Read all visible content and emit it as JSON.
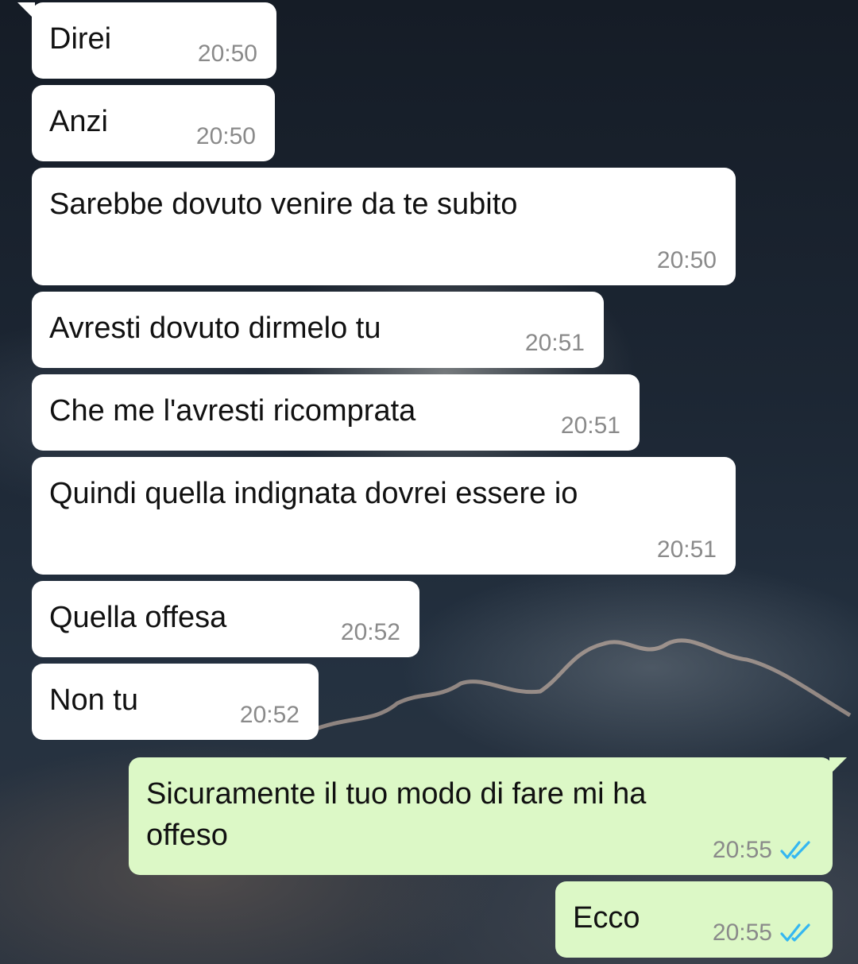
{
  "messages": [
    {
      "text": "Direi",
      "time": "20:50",
      "direction": "incoming"
    },
    {
      "text": "Anzi",
      "time": "20:50",
      "direction": "incoming"
    },
    {
      "text": "Sarebbe dovuto venire da te subito",
      "time": "20:50",
      "direction": "incoming"
    },
    {
      "text": "Avresti dovuto dirmelo tu",
      "time": "20:51",
      "direction": "incoming"
    },
    {
      "text": "Che me l'avresti ricomprata",
      "time": "20:51",
      "direction": "incoming"
    },
    {
      "text": "Quindi quella indignata dovrei essere io",
      "time": "20:51",
      "direction": "incoming"
    },
    {
      "text": "Quella offesa",
      "time": "20:52",
      "direction": "incoming"
    },
    {
      "text": "Non tu",
      "time": "20:52",
      "direction": "incoming"
    },
    {
      "text": "Sicuramente il tuo modo di fare mi ha offeso",
      "time": "20:55",
      "direction": "outgoing",
      "status": "read"
    },
    {
      "text": "Ecco",
      "time": "20:55",
      "direction": "outgoing",
      "status": "read"
    }
  ],
  "colors": {
    "incoming_bubble": "#ffffff",
    "outgoing_bubble": "#dcf8c6",
    "read_tick": "#34b7f1",
    "timestamp": "#8a8a8a"
  },
  "icons": {
    "read_status": "double-check-icon"
  }
}
